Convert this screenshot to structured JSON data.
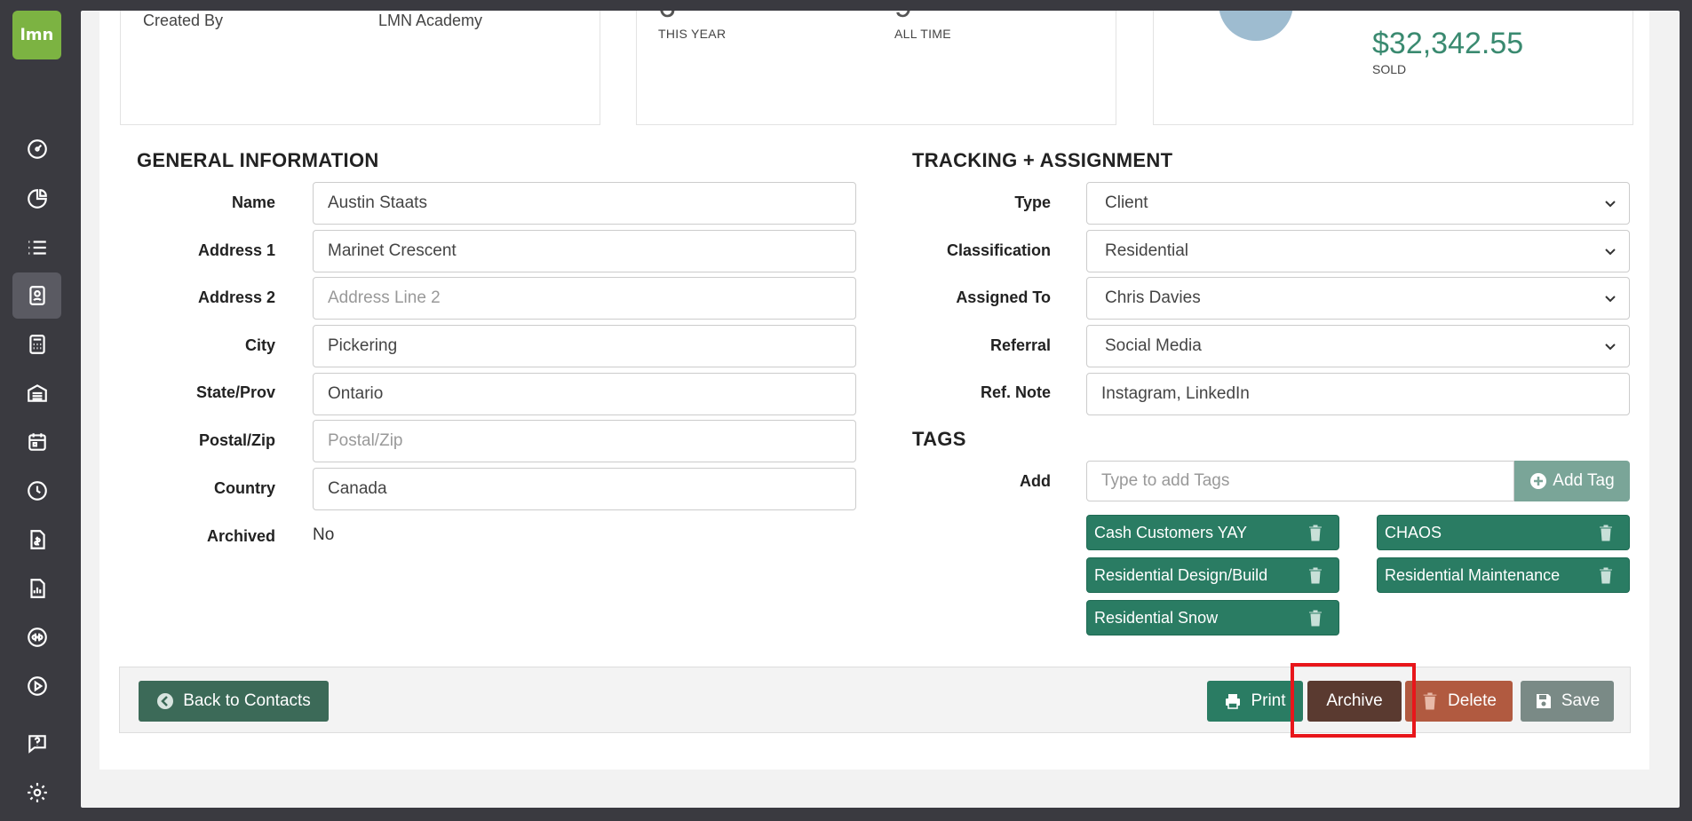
{
  "logo": {
    "text": "lmn"
  },
  "nav": {
    "items": [
      {
        "name": "dashboard-icon"
      },
      {
        "name": "pie-chart-icon"
      },
      {
        "name": "list-icon"
      },
      {
        "name": "contacts-icon",
        "active": true
      },
      {
        "name": "calculator-icon"
      },
      {
        "name": "warehouse-icon"
      },
      {
        "name": "calendar-icon"
      },
      {
        "name": "clock-icon"
      },
      {
        "name": "invoice-icon"
      },
      {
        "name": "report-icon"
      },
      {
        "name": "quickbooks-icon"
      },
      {
        "name": "play-icon"
      },
      {
        "name": "help-icon"
      },
      {
        "name": "gear-icon"
      }
    ]
  },
  "cards": {
    "created_by_label": "Created By",
    "created_by_value": "LMN Academy",
    "this_year_label": "THIS YEAR",
    "all_time_label": "ALL TIME",
    "sold_amount": "$32,342.55",
    "sold_label": "SOLD"
  },
  "general": {
    "title": "GENERAL INFORMATION",
    "name_label": "Name",
    "name_value": "Austin Staats",
    "address1_label": "Address 1",
    "address1_value": "Marinet Crescent",
    "address2_label": "Address 2",
    "address2_placeholder": "Address Line 2",
    "city_label": "City",
    "city_value": "Pickering",
    "state_label": "State/Prov",
    "state_value": "Ontario",
    "postal_label": "Postal/Zip",
    "postal_placeholder": "Postal/Zip",
    "country_label": "Country",
    "country_value": "Canada",
    "archived_label": "Archived",
    "archived_value": "No"
  },
  "tracking": {
    "title": "TRACKING + ASSIGNMENT",
    "type_label": "Type",
    "type_value": "Client",
    "classification_label": "Classification",
    "classification_value": "Residential",
    "assigned_label": "Assigned To",
    "assigned_value": "Chris Davies",
    "referral_label": "Referral",
    "referral_value": "Social Media",
    "refnote_label": "Ref. Note",
    "refnote_value": "Instagram, LinkedIn"
  },
  "tags": {
    "title": "TAGS",
    "add_label": "Add",
    "input_placeholder": "Type to add Tags",
    "add_button": "Add Tag",
    "list": [
      "Cash Customers YAY",
      "CHAOS",
      "Residential Design/Build",
      "Residential Maintenance",
      "Residential Snow"
    ]
  },
  "footer": {
    "back_label": "Back to Contacts",
    "print_label": "Print",
    "archive_label": "Archive",
    "delete_label": "Delete",
    "save_label": "Save"
  },
  "colors": {
    "accent": "#2a7c63",
    "highlight": "#e8161b"
  }
}
